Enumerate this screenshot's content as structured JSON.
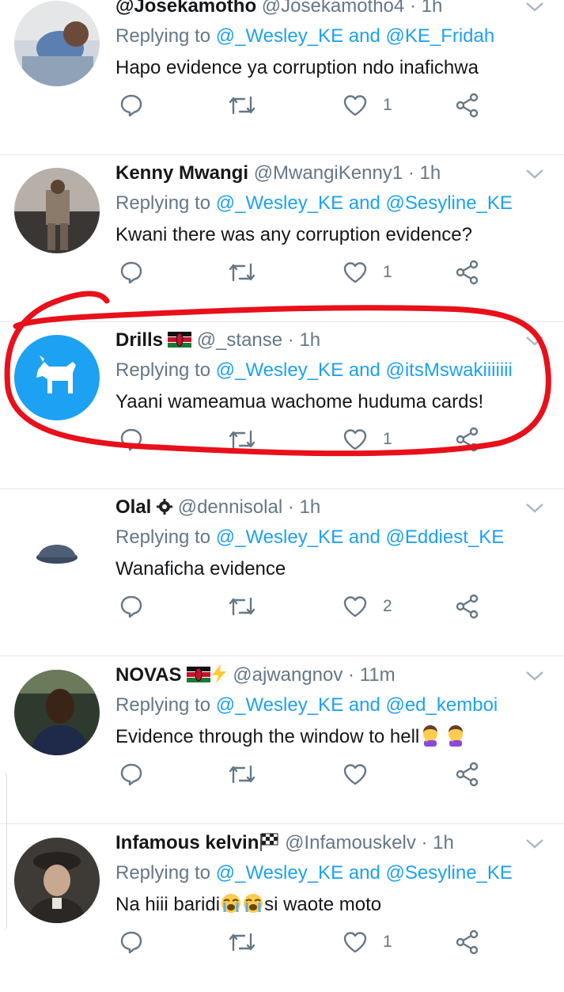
{
  "colors": {
    "link": "#1da1f2",
    "muted": "#657786",
    "text": "#14171a",
    "scribble": "#e8101a"
  },
  "tweets": [
    {
      "name": "@Josekamotho",
      "handle": "@Josekamotho4",
      "time": "· 1h",
      "replying_prefix": "Replying to ",
      "reply_a": "@_Wesley_KE",
      "reply_and": " and ",
      "reply_b": "@KE_Fridah",
      "text": "Hapo evidence ya corruption ndo inafichwa",
      "likes": "1"
    },
    {
      "name": "Kenny Mwangi",
      "handle": "@MwangiKenny1",
      "time": "· 1h",
      "replying_prefix": "Replying to ",
      "reply_a": "@_Wesley_KE",
      "reply_and": " and ",
      "reply_b": "@Sesyline_KE",
      "text": "Kwani there was any corruption evidence?",
      "likes": "1"
    },
    {
      "name": "Drills",
      "handle": "@_stanse",
      "time": "· 1h",
      "replying_prefix": "Replying to ",
      "reply_a": "@_Wesley_KE",
      "reply_and": " and ",
      "reply_b": "@itsMswakiiiiiii",
      "text": "Yaani wameamua wachome huduma cards!",
      "likes": "1"
    },
    {
      "name": "Olal",
      "handle": "@dennisolal",
      "time": "· 1h",
      "replying_prefix": "Replying to ",
      "reply_a": "@_Wesley_KE",
      "reply_and": " and ",
      "reply_b": "@Eddiest_KE",
      "text": "Wanaficha evidence",
      "likes": "2"
    },
    {
      "name": "NOVAS",
      "handle": "@ajwangnov",
      "time": "· 11m",
      "replying_prefix": "Replying to ",
      "reply_a": "@_Wesley_KE",
      "reply_and": " and ",
      "reply_b": "@ed_kemboi",
      "text": "Evidence through the window to hell",
      "likes": ""
    },
    {
      "name": "Infamous kelvin",
      "handle": "@Infamouskelv",
      "time": "· 1h",
      "replying_prefix": "Replying to ",
      "reply_a": "@_Wesley_KE",
      "reply_and": " and ",
      "reply_b": "@Sesyline_KE",
      "text_a": "Na hiii baridi",
      "text_b": "si waote moto",
      "likes": "1"
    }
  ],
  "icons": [
    "reply-icon",
    "retweet-icon",
    "like-icon",
    "share-icon",
    "chevron-down-icon",
    "kenya-flag-icon",
    "lightning-icon",
    "chequered-flag-icon",
    "gear-badge-icon",
    "goat-icon",
    "woman-facepalming-emoji",
    "crying-face-emoji"
  ]
}
